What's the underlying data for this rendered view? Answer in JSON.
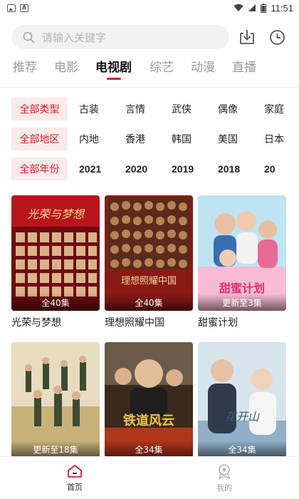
{
  "status_bar": {
    "time": "11:51"
  },
  "search": {
    "placeholder": "请输入关键字"
  },
  "tabs": [
    {
      "label": "推荐",
      "active": false
    },
    {
      "label": "电影",
      "active": false
    },
    {
      "label": "电视剧",
      "active": true
    },
    {
      "label": "综艺",
      "active": false
    },
    {
      "label": "动漫",
      "active": false
    },
    {
      "label": "直播",
      "active": false
    }
  ],
  "filters": {
    "type": {
      "label": "全部类型",
      "options": [
        "古装",
        "言情",
        "武侠",
        "偶像",
        "家庭"
      ]
    },
    "region": {
      "label": "全部地区",
      "options": [
        "内地",
        "香港",
        "韩国",
        "美国",
        "日本"
      ]
    },
    "year": {
      "label": "全部年份",
      "options": [
        "2021",
        "2020",
        "2019",
        "2018",
        "20"
      ]
    }
  },
  "cards": [
    {
      "title": "光荣与梦想",
      "badge": "全40集",
      "poster_text": "光荣与梦想",
      "color": "#b8141c"
    },
    {
      "title": "理想照耀中国",
      "badge": "全40集",
      "poster_text": "理想照耀中国",
      "color": "#8a1a14"
    },
    {
      "title": "甜蜜计划",
      "badge": "更新至3集",
      "poster_text": "甜蜜计划",
      "color": "#f3a6c6"
    },
    {
      "title": "",
      "badge": "更新至18集",
      "poster_text": "",
      "color": "#c8b27a"
    },
    {
      "title": "",
      "badge": "全34集",
      "poster_text": "铁道风云",
      "color": "#3a2a1c"
    },
    {
      "title": "",
      "badge": "全34集",
      "poster_text": "花开山",
      "color": "#8fb0c8"
    }
  ],
  "bottom_nav": [
    {
      "label": "首页",
      "icon": "home-icon",
      "active": true
    },
    {
      "label": "我的",
      "icon": "profile-icon",
      "active": false
    }
  ],
  "colors": {
    "accent": "#d81e2c",
    "filter_bg": "#fbeaea"
  }
}
